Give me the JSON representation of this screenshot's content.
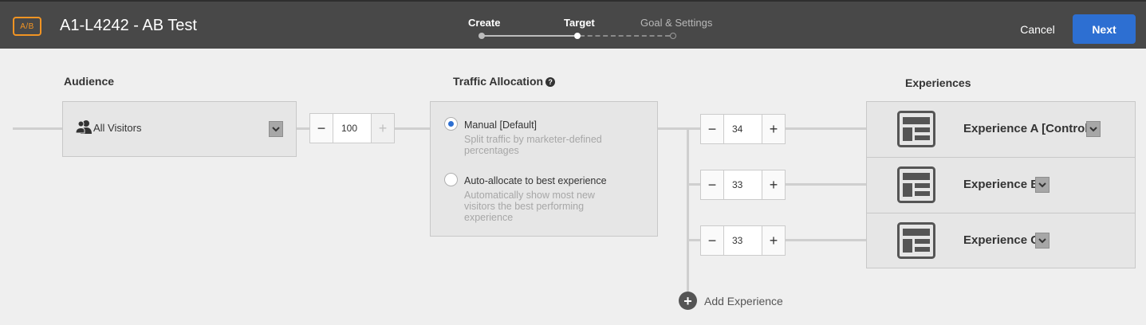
{
  "header": {
    "badge": "A/B",
    "title": "A1-L4242 - AB Test",
    "steps": [
      {
        "label": "Create",
        "state": "done"
      },
      {
        "label": "Target",
        "state": "current"
      },
      {
        "label": "Goal & Settings",
        "state": "todo"
      }
    ],
    "cancel_label": "Cancel",
    "next_label": "Next"
  },
  "audience": {
    "heading": "Audience",
    "selected": "All Visitors",
    "icon": "users-icon",
    "allocation": "100"
  },
  "traffic": {
    "heading": "Traffic Allocation",
    "options": [
      {
        "label": "Manual [Default]",
        "desc": "Split traffic by marketer-defined percentages",
        "selected": true
      },
      {
        "label": "Auto-allocate to best experience",
        "desc": "Automatically show most new visitors the best performing experience",
        "selected": false
      }
    ],
    "allocations": [
      "34",
      "33",
      "33"
    ]
  },
  "experiences": {
    "heading": "Experiences",
    "items": [
      {
        "name": "Experience A [Control]",
        "icon": "layout-icon"
      },
      {
        "name": "Experience B",
        "icon": "layout-icon"
      },
      {
        "name": "Experience C",
        "icon": "layout-icon"
      }
    ],
    "add_label": "Add Experience"
  },
  "colors": {
    "header_bg": "#484848",
    "accent_blue": "#2d6fd2",
    "badge_orange": "#f29423",
    "canvas_bg": "#efefef"
  }
}
